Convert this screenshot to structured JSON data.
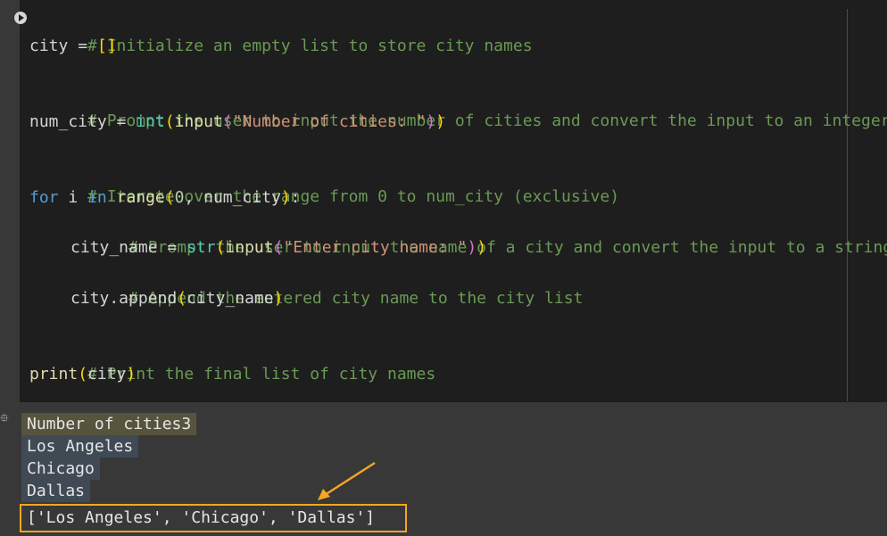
{
  "code": {
    "lines": [
      {
        "comment": "# Initialize an empty list to store city names"
      },
      {
        "t1": "city",
        "t2": " = ",
        "t3": "[]"
      },
      {
        "comment": "# Prompt the user to input the number of cities and convert the input to an integer"
      },
      {
        "t1": "num_city",
        "t2": " = ",
        "t3": "int",
        "t4": "(",
        "t5": "input",
        "t6": "(",
        "t7": "\"Number of cities: \"",
        "t8": ")",
        "t9": ")"
      },
      {
        "comment": "# Iterate over the range from 0 to num_city (exclusive)"
      },
      {
        "t1": "for",
        "t2": " i ",
        "t3": "in",
        "t4": " ",
        "t5": "range",
        "t6": "(",
        "t7": "0",
        "t8": ", num_city",
        "t9": ")",
        "t10": ":"
      },
      {
        "comment": "# Prompt the user to input the name of a city and convert the input to a string"
      },
      {
        "t1": "city_name",
        "t2": " = ",
        "t3": "str",
        "t4": "(",
        "t5": "input",
        "t6": "(",
        "t7": "\"Enter city name: \"",
        "t8": ")",
        "t9": ")"
      },
      {
        "comment": "# Append the entered city name to the city list"
      },
      {
        "t1": "city.append",
        "t2": "(",
        "t3": "city_name",
        "t4": ")"
      },
      {
        "comment": "# Print the final list of city names"
      },
      {
        "t1": "print",
        "t2": "(",
        "t3": "city",
        "t4": ")"
      }
    ]
  },
  "output": {
    "prompt_line": "Number of cities3",
    "inputs": [
      "Los Angeles",
      "Chicago",
      "Dallas"
    ],
    "result": "['Los Angeles', 'Chicago', 'Dallas']"
  },
  "colors": {
    "highlight_box": "#f5a623",
    "arrow": "#f5a623"
  },
  "icons": {
    "run": "play-icon",
    "output": "output-settings-icon",
    "annotation": "arrow-annotation"
  }
}
